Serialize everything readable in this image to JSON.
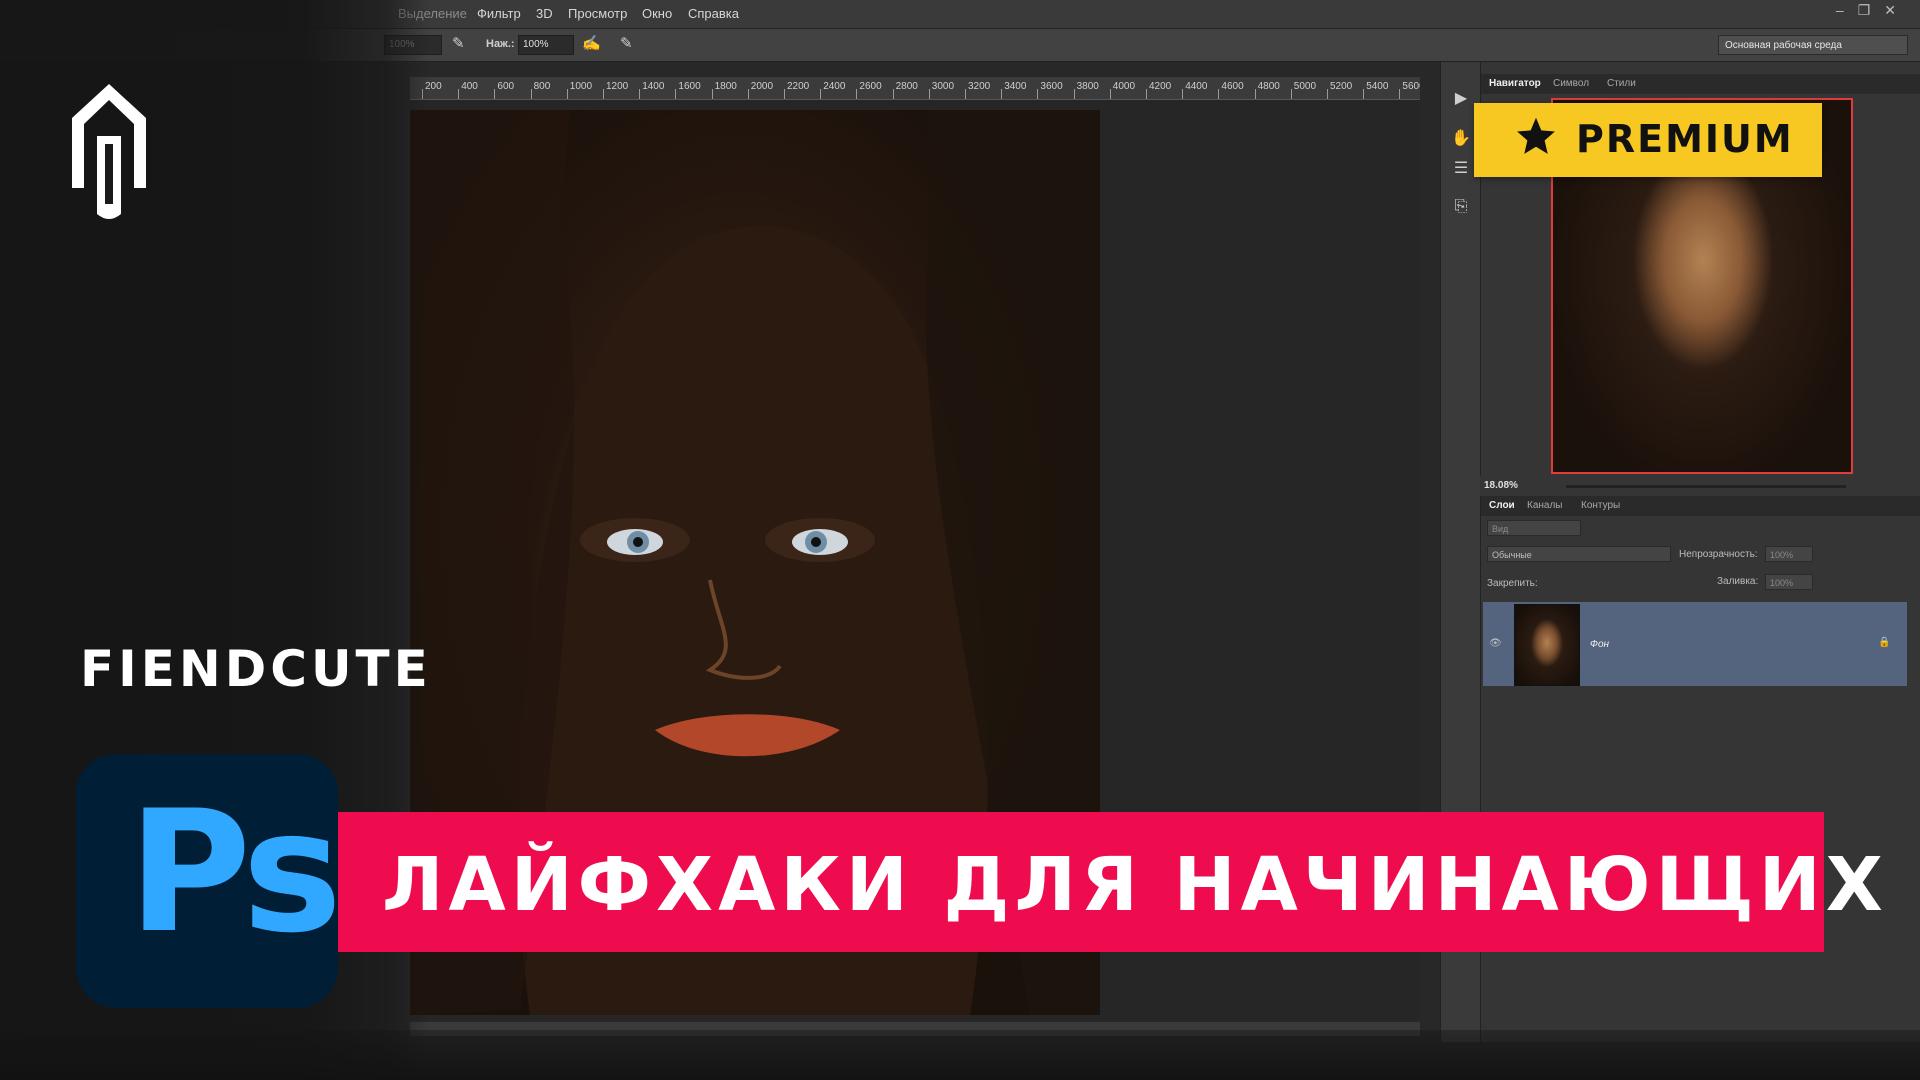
{
  "menu": {
    "items": [
      "Выделение",
      "Фильтр",
      "3D",
      "Просмотр",
      "Окно",
      "Справка"
    ]
  },
  "options_bar": {
    "pressure_label": "Наж.:",
    "pressure_value": "100%",
    "opacity_value": "100%"
  },
  "workspace": {
    "label": "Основная рабочая среда"
  },
  "ruler": {
    "ticks": [
      "200",
      "400",
      "600",
      "800",
      "1000",
      "1200",
      "1400",
      "1600",
      "1800",
      "2000",
      "2200",
      "2400",
      "2600",
      "2800",
      "3000",
      "3200",
      "3400",
      "3600",
      "3800",
      "4000",
      "4200",
      "4400",
      "4600",
      "4800",
      "5000",
      "5200",
      "5400",
      "5600"
    ]
  },
  "navigator": {
    "tabs": [
      "Навигатор",
      "Символ",
      "Стили"
    ],
    "zoom": "18.08%"
  },
  "layers": {
    "tabs": [
      "Слои",
      "Каналы",
      "Контуры"
    ],
    "filter_label": "Вид",
    "blend_mode": "Обычные",
    "opacity_label": "Непрозрачность:",
    "opacity_value": "100%",
    "lock_label": "Закрепить:",
    "fill_label": "Заливка:",
    "fill_value": "100%",
    "items": [
      {
        "name": "Фон"
      }
    ]
  },
  "overlay": {
    "premium_label": "PREMIUM",
    "brand": "FIENDCUTE",
    "banner_text": "ЛАЙФХАКИ ДЛЯ НАЧИНАЮЩИХ",
    "ps_logo_text": "Ps"
  },
  "colors": {
    "banner": "#ee0c4f",
    "premium": "#f7c821",
    "ps_logo_bg": "#001e36",
    "ps_logo_text": "#31a8ff"
  },
  "icons": [
    "logo-icon",
    "star-icon",
    "eye-icon",
    "lock-icon",
    "play-icon",
    "brush-icon",
    "adjust-icon",
    "history-icon"
  ]
}
